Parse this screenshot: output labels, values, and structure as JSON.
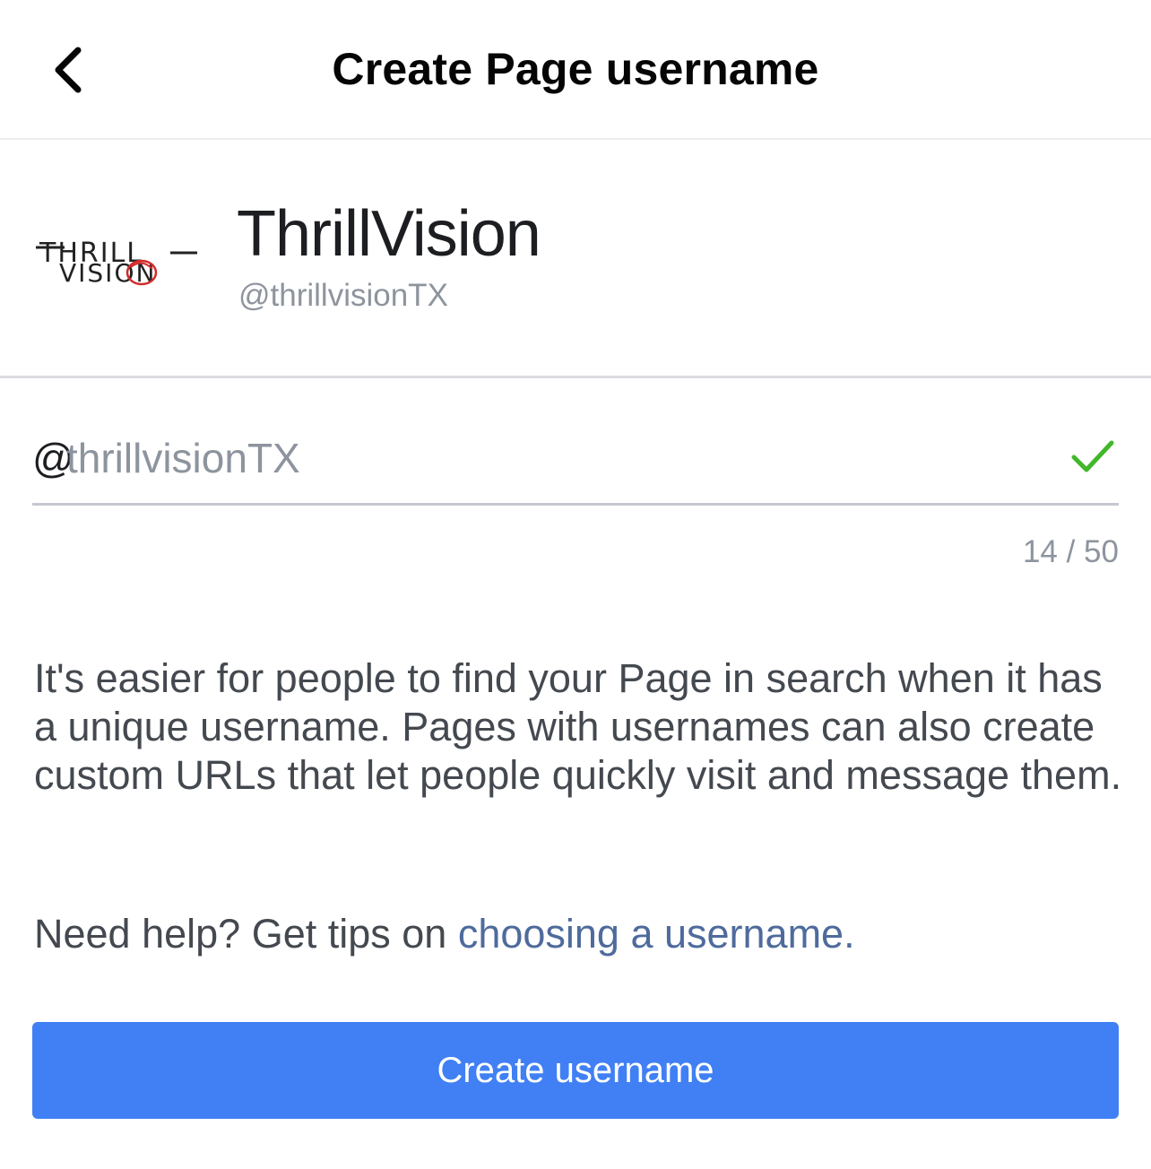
{
  "header": {
    "title": "Create Page username",
    "back_icon": "chevron-left-icon"
  },
  "profile": {
    "logo_text": "THRILL VISION",
    "name": "ThrillVision",
    "handle": "@thrillvisionTX"
  },
  "username_field": {
    "prefix": "@",
    "value": "thrillvisionTX",
    "status_icon": "checkmark-icon",
    "status_color": "#42b72a",
    "counter": "14 / 50"
  },
  "description": "It's easier for people to find your Page in search when it has a unique username. Pages with usernames can also create custom URLs that let people quickly visit and message them.",
  "help": {
    "prefix": "Need help? Get tips on ",
    "link_label": "choosing a username."
  },
  "primary_button": {
    "label": "Create username",
    "color": "#4080f4"
  }
}
